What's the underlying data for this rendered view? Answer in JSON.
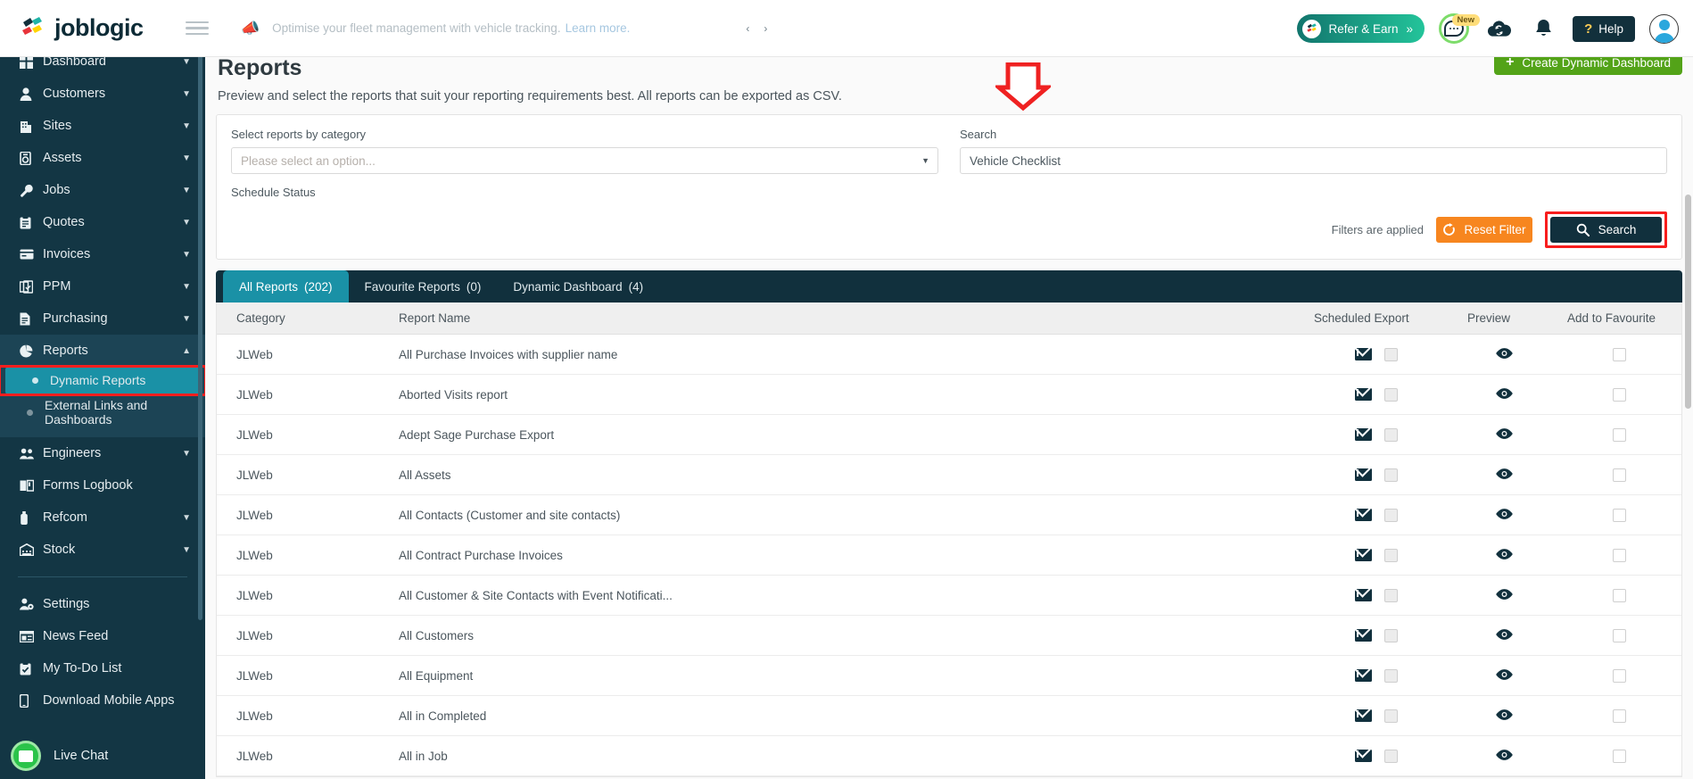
{
  "brand": {
    "name": "joblogic"
  },
  "announcement": {
    "icon": "megaphone-icon",
    "text": "Optimise your fleet management with vehicle tracking.",
    "link": "Learn more.",
    "prev": "‹",
    "next": "›"
  },
  "topbar": {
    "refer_label": "Refer & Earn",
    "refer_chevrons": "»",
    "chat_badge": "New",
    "help_label": "Help",
    "help_mark": "?"
  },
  "sidebar": {
    "items": [
      {
        "label": "Dashboard",
        "icon": "dashboard-icon",
        "glyph": "■",
        "chevron": "⌄",
        "expandable": true
      },
      {
        "label": "Customers",
        "icon": "person-icon",
        "glyph": "👤",
        "chevron": "⌄",
        "expandable": true
      },
      {
        "label": "Sites",
        "icon": "building-icon",
        "glyph": "🏢",
        "chevron": "⌄",
        "expandable": true
      },
      {
        "label": "Assets",
        "icon": "asset-icon",
        "glyph": "▤",
        "chevron": "⌄",
        "expandable": true
      },
      {
        "label": "Jobs",
        "icon": "wrench-icon",
        "glyph": "🔧",
        "chevron": "⌄",
        "expandable": true
      },
      {
        "label": "Quotes",
        "icon": "clipboard-icon",
        "glyph": "📋",
        "chevron": "⌄",
        "expandable": true
      },
      {
        "label": "Invoices",
        "icon": "invoice-icon",
        "glyph": "▬",
        "chevron": "⌄",
        "expandable": true
      },
      {
        "label": "PPM",
        "icon": "calendar-check-icon",
        "glyph": "📅",
        "chevron": "⌄",
        "expandable": true
      },
      {
        "label": "Purchasing",
        "icon": "document-icon",
        "glyph": "📄",
        "chevron": "⌄",
        "expandable": true
      }
    ],
    "reports": {
      "label": "Reports",
      "icon": "pie-chart-icon",
      "chevron": "⌃",
      "sub": [
        {
          "label": "Dynamic Reports",
          "active": true,
          "highlighted": true
        },
        {
          "label": "External Links and Dashboards",
          "active": false,
          "highlighted": false
        }
      ]
    },
    "items_after": [
      {
        "label": "Engineers",
        "icon": "people-icon",
        "glyph": "👥",
        "chevron": "⌄",
        "expandable": true
      },
      {
        "label": "Forms Logbook",
        "icon": "book-icon",
        "glyph": "📖",
        "chevron": "",
        "expandable": false
      },
      {
        "label": "Refcom",
        "icon": "cylinder-icon",
        "glyph": "🗲",
        "chevron": "⌄",
        "expandable": true
      },
      {
        "label": "Stock",
        "icon": "warehouse-icon",
        "glyph": "🏬",
        "chevron": "⌄",
        "expandable": true
      }
    ],
    "items_footer": [
      {
        "label": "Settings",
        "icon": "settings-user-icon",
        "glyph": "⚙",
        "chevron": "",
        "expandable": false
      },
      {
        "label": "News Feed",
        "icon": "news-icon",
        "glyph": "🗞",
        "chevron": "",
        "expandable": false
      },
      {
        "label": "My To-Do List",
        "icon": "todo-icon",
        "glyph": "☑",
        "chevron": "",
        "expandable": false
      },
      {
        "label": "Download Mobile Apps",
        "icon": "mobile-icon",
        "glyph": "📱",
        "chevron": "",
        "expandable": false
      }
    ],
    "live_chat": {
      "label": "Live Chat",
      "icon": "chat-icon"
    }
  },
  "page": {
    "title": "Reports",
    "subtitle": "Preview and select the reports that suit your reporting requirements best. All reports can be exported as CSV.",
    "create_button": "Create Dynamic Dashboard",
    "create_plus": "+"
  },
  "filters": {
    "category_label": "Select reports by category",
    "category_placeholder": "Please select an option...",
    "category_value": "",
    "search_label": "Search",
    "search_value": "Vehicle Checklist",
    "schedule_status_label": "Schedule Status",
    "filters_applied_text": "Filters are applied",
    "reset_label": "Reset Filter",
    "search_button_label": "Search"
  },
  "tabs": [
    {
      "label": "All Reports",
      "count": "(202)",
      "active": true
    },
    {
      "label": "Favourite Reports",
      "count": "(0)",
      "active": false
    },
    {
      "label": "Dynamic Dashboard",
      "count": "(4)",
      "active": false
    }
  ],
  "table": {
    "columns": [
      "Category",
      "Report Name",
      "Scheduled Export",
      "Preview",
      "Add to Favourite"
    ],
    "rows": [
      {
        "category": "JLWeb",
        "name": "All Purchase Invoices with supplier name"
      },
      {
        "category": "JLWeb",
        "name": "Aborted Visits report"
      },
      {
        "category": "JLWeb",
        "name": "Adept Sage Purchase Export"
      },
      {
        "category": "JLWeb",
        "name": "All Assets"
      },
      {
        "category": "JLWeb",
        "name": "All Contacts (Customer and site contacts)"
      },
      {
        "category": "JLWeb",
        "name": "All Contract Purchase Invoices"
      },
      {
        "category": "JLWeb",
        "name": "All Customer & Site Contacts with Event Notificati..."
      },
      {
        "category": "JLWeb",
        "name": "All Customers"
      },
      {
        "category": "JLWeb",
        "name": "All Equipment"
      },
      {
        "category": "JLWeb",
        "name": "All in Completed"
      },
      {
        "category": "JLWeb",
        "name": "All in Job"
      }
    ]
  },
  "colors": {
    "sidebar_bg": "#133644",
    "accent_teal": "#1a91a6",
    "dark_navy": "#11303d",
    "orange": "#f7861f",
    "green": "#53a318",
    "highlight_red": "#f81e1e"
  }
}
